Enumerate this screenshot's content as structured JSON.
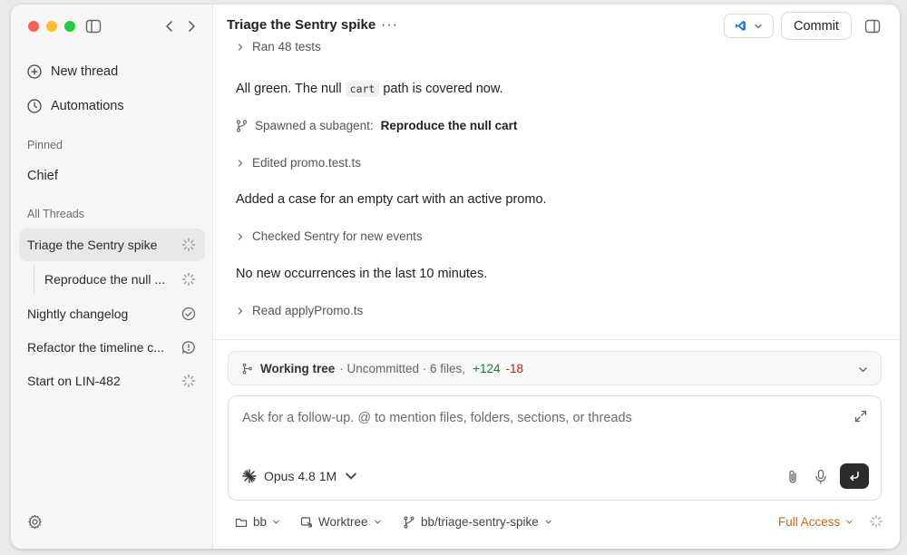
{
  "sidebar": {
    "nav": [
      {
        "label": "New thread",
        "icon": "plus-circle-icon"
      },
      {
        "label": "Automations",
        "icon": "clock-icon"
      }
    ],
    "pinned_label": "Pinned",
    "pinned": [
      {
        "label": "Chief"
      }
    ],
    "threads_label": "All Threads",
    "threads": [
      {
        "label": "Triage the Sentry spike",
        "status": "loading-spinner-icon"
      },
      {
        "label": "Reproduce the null ...",
        "status": "loading-spinner-icon"
      },
      {
        "label": "Nightly changelog",
        "status": "check-circle-icon"
      },
      {
        "label": "Refactor the timeline c...",
        "status": "chat-bubble-icon"
      },
      {
        "label": "Start on LIN-482",
        "status": "loading-spinner-icon"
      }
    ]
  },
  "header": {
    "title": "Triage the Sentry spike",
    "more": "···",
    "commit_label": "Commit"
  },
  "transcript": {
    "ran_tests": "Ran 48 tests",
    "msg1_before": "All green. The null ",
    "msg1_code": "cart",
    "msg1_after": " path is covered now.",
    "subagent_prefix": "Spawned a subagent:",
    "subagent_name": "Reproduce the null cart",
    "edited": "Edited promo.test.ts",
    "msg2": "Added a case for an empty cart with an active promo.",
    "checked": "Checked Sentry for new events",
    "msg3": "No new occurrences in the last 10 minutes.",
    "read": "Read applyPromo.ts"
  },
  "working_tree": {
    "title": "Working tree",
    "status": "· Uncommitted · 6 files,",
    "additions": "+124",
    "deletions": "-18"
  },
  "composer": {
    "placeholder": "Ask for a follow-up. @ to mention files, folders, sections, or threads",
    "model": "Opus 4.8 1M"
  },
  "footer": {
    "folder": "bb",
    "mode": "Worktree",
    "branch": "bb/triage-sentry-spike",
    "access": "Full Access"
  },
  "colors": {
    "accent_full_access": "#c2691e",
    "additions": "#1a7f37",
    "deletions": "#b42318",
    "vscode_blue": "#1f7fd8"
  }
}
